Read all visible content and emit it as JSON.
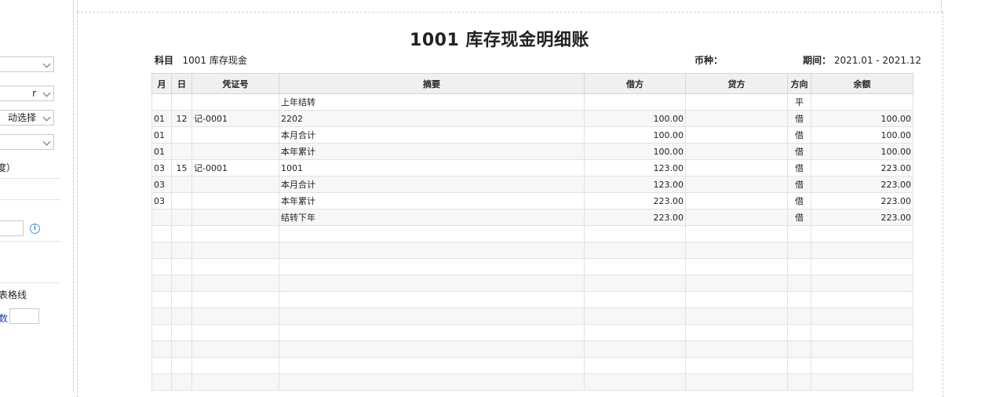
{
  "left_panel": {
    "select1": "",
    "select2": "r",
    "select3": "动选择",
    "select4": "",
    "label_1": "度）",
    "label_2": "表格线",
    "label_3": "数"
  },
  "report": {
    "title": "1001 库存现金明细账",
    "subject_label": "科目",
    "subject_value": "1001 库存现金",
    "currency_label": "币种：",
    "currency_value": "",
    "period_label": "期间：",
    "period_value": "2021.01 - 2021.12"
  },
  "columns": [
    "月",
    "日",
    "凭证号",
    "摘要",
    "借方",
    "贷方",
    "方向",
    "余额"
  ],
  "rows": [
    {
      "month": "",
      "day": "",
      "voucher": "",
      "summary": "上年结转",
      "debit": "",
      "credit": "",
      "direction": "平",
      "balance": ""
    },
    {
      "month": "01",
      "day": "12",
      "voucher": "记-0001",
      "summary": "2202",
      "debit": "100.00",
      "credit": "",
      "direction": "借",
      "balance": "100.00"
    },
    {
      "month": "01",
      "day": "",
      "voucher": "",
      "summary": "本月合计",
      "debit": "100.00",
      "credit": "",
      "direction": "借",
      "balance": "100.00"
    },
    {
      "month": "01",
      "day": "",
      "voucher": "",
      "summary": "本年累计",
      "debit": "100.00",
      "credit": "",
      "direction": "借",
      "balance": "100.00"
    },
    {
      "month": "03",
      "day": "15",
      "voucher": "记-0001",
      "summary": "1001",
      "debit": "123.00",
      "credit": "",
      "direction": "借",
      "balance": "223.00"
    },
    {
      "month": "03",
      "day": "",
      "voucher": "",
      "summary": "本月合计",
      "debit": "123.00",
      "credit": "",
      "direction": "借",
      "balance": "223.00"
    },
    {
      "month": "03",
      "day": "",
      "voucher": "",
      "summary": "本年累计",
      "debit": "223.00",
      "credit": "",
      "direction": "借",
      "balance": "223.00"
    },
    {
      "month": "",
      "day": "",
      "voucher": "",
      "summary": "结转下年",
      "debit": "223.00",
      "credit": "",
      "direction": "借",
      "balance": "223.00"
    },
    {
      "month": "",
      "day": "",
      "voucher": "",
      "summary": "",
      "debit": "",
      "credit": "",
      "direction": "",
      "balance": ""
    },
    {
      "month": "",
      "day": "",
      "voucher": "",
      "summary": "",
      "debit": "",
      "credit": "",
      "direction": "",
      "balance": ""
    },
    {
      "month": "",
      "day": "",
      "voucher": "",
      "summary": "",
      "debit": "",
      "credit": "",
      "direction": "",
      "balance": ""
    },
    {
      "month": "",
      "day": "",
      "voucher": "",
      "summary": "",
      "debit": "",
      "credit": "",
      "direction": "",
      "balance": ""
    },
    {
      "month": "",
      "day": "",
      "voucher": "",
      "summary": "",
      "debit": "",
      "credit": "",
      "direction": "",
      "balance": ""
    },
    {
      "month": "",
      "day": "",
      "voucher": "",
      "summary": "",
      "debit": "",
      "credit": "",
      "direction": "",
      "balance": ""
    },
    {
      "month": "",
      "day": "",
      "voucher": "",
      "summary": "",
      "debit": "",
      "credit": "",
      "direction": "",
      "balance": ""
    },
    {
      "month": "",
      "day": "",
      "voucher": "",
      "summary": "",
      "debit": "",
      "credit": "",
      "direction": "",
      "balance": ""
    },
    {
      "month": "",
      "day": "",
      "voucher": "",
      "summary": "",
      "debit": "",
      "credit": "",
      "direction": "",
      "balance": ""
    },
    {
      "month": "",
      "day": "",
      "voucher": "",
      "summary": "",
      "debit": "",
      "credit": "",
      "direction": "",
      "balance": ""
    }
  ]
}
